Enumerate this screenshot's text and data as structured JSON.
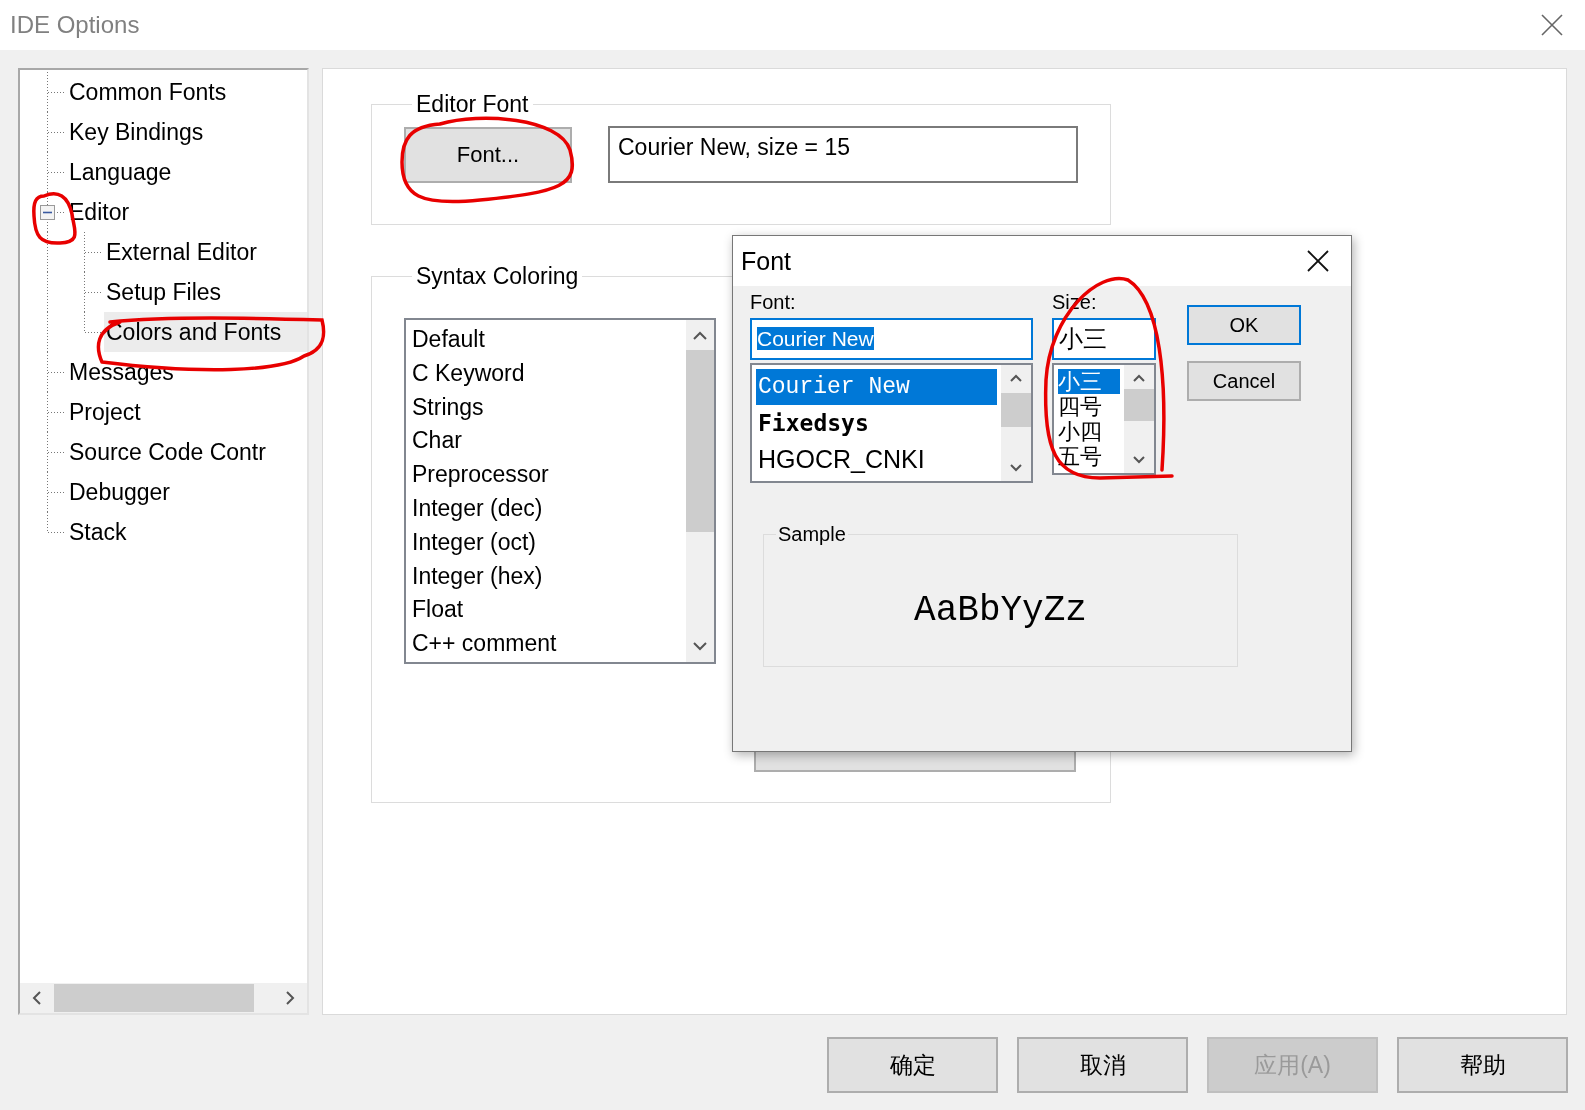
{
  "window": {
    "title": "IDE Options"
  },
  "tree": [
    {
      "label": "Common Fonts",
      "selected": false
    },
    {
      "label": "Key Bindings",
      "selected": false
    },
    {
      "label": "Language",
      "selected": false
    },
    {
      "label": "Editor",
      "selected": false,
      "expanded": true,
      "children": [
        {
          "label": "External Editor",
          "selected": false
        },
        {
          "label": "Setup Files",
          "selected": false
        },
        {
          "label": "Colors and Fonts",
          "selected": true
        }
      ]
    },
    {
      "label": "Messages",
      "selected": false
    },
    {
      "label": "Project",
      "selected": false
    },
    {
      "label": "Source Code Contr",
      "selected": false
    },
    {
      "label": "Debugger",
      "selected": false
    },
    {
      "label": "Stack",
      "selected": false
    }
  ],
  "editor_font": {
    "title": "Editor Font",
    "button": "Font...",
    "value": "Courier New, size = 15"
  },
  "syntax_coloring": {
    "title": "Syntax Coloring",
    "items": [
      "Default",
      "C Keyword",
      "Strings",
      "Char",
      "Preprocessor",
      "Integer (dec)",
      "Integer (oct)",
      "Integer (hex)",
      "Float",
      "C++ comment"
    ]
  },
  "font_dialog": {
    "title": "Font",
    "font_label": "Font:",
    "font_value": "Courier New",
    "fonts": [
      {
        "label": "Courier New",
        "selected": true,
        "kind": "mono"
      },
      {
        "label": "Fixedsys",
        "selected": false,
        "kind": "bold"
      },
      {
        "label": "HGOCR_CNKI",
        "selected": false,
        "kind": "sans"
      }
    ],
    "size_label": "Size:",
    "size_value": "小三",
    "sizes": [
      {
        "label": "小三",
        "selected": true
      },
      {
        "label": "四号",
        "selected": false
      },
      {
        "label": "小四",
        "selected": false
      },
      {
        "label": "五号",
        "selected": false
      }
    ],
    "ok": "OK",
    "cancel": "Cancel",
    "sample_title": "Sample",
    "sample_text": "AaBbYyZz"
  },
  "buttons": [
    {
      "label": "确定",
      "disabled": false
    },
    {
      "label": "取消",
      "disabled": false
    },
    {
      "label": "应用(A)",
      "disabled": true
    },
    {
      "label": "帮助",
      "disabled": false
    }
  ]
}
